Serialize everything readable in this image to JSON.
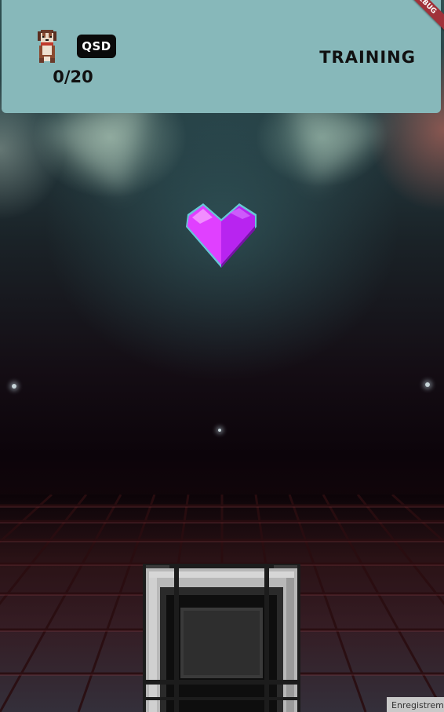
{
  "hud": {
    "key_label": "QSD",
    "counter": "0/20",
    "mode": "TRAINING"
  },
  "debug_banner": "DEBUG",
  "status_label": "Enregistreme",
  "colors": {
    "hud_background": "#87b8ba",
    "heart_primary": "#b824f0",
    "heart_highlight": "#e040ff",
    "frame_steel": "#b8b8b8"
  },
  "icons": {
    "player": "dog-icon",
    "falling_note": "heart-icon",
    "catch_zone": "square-frame-icon"
  }
}
